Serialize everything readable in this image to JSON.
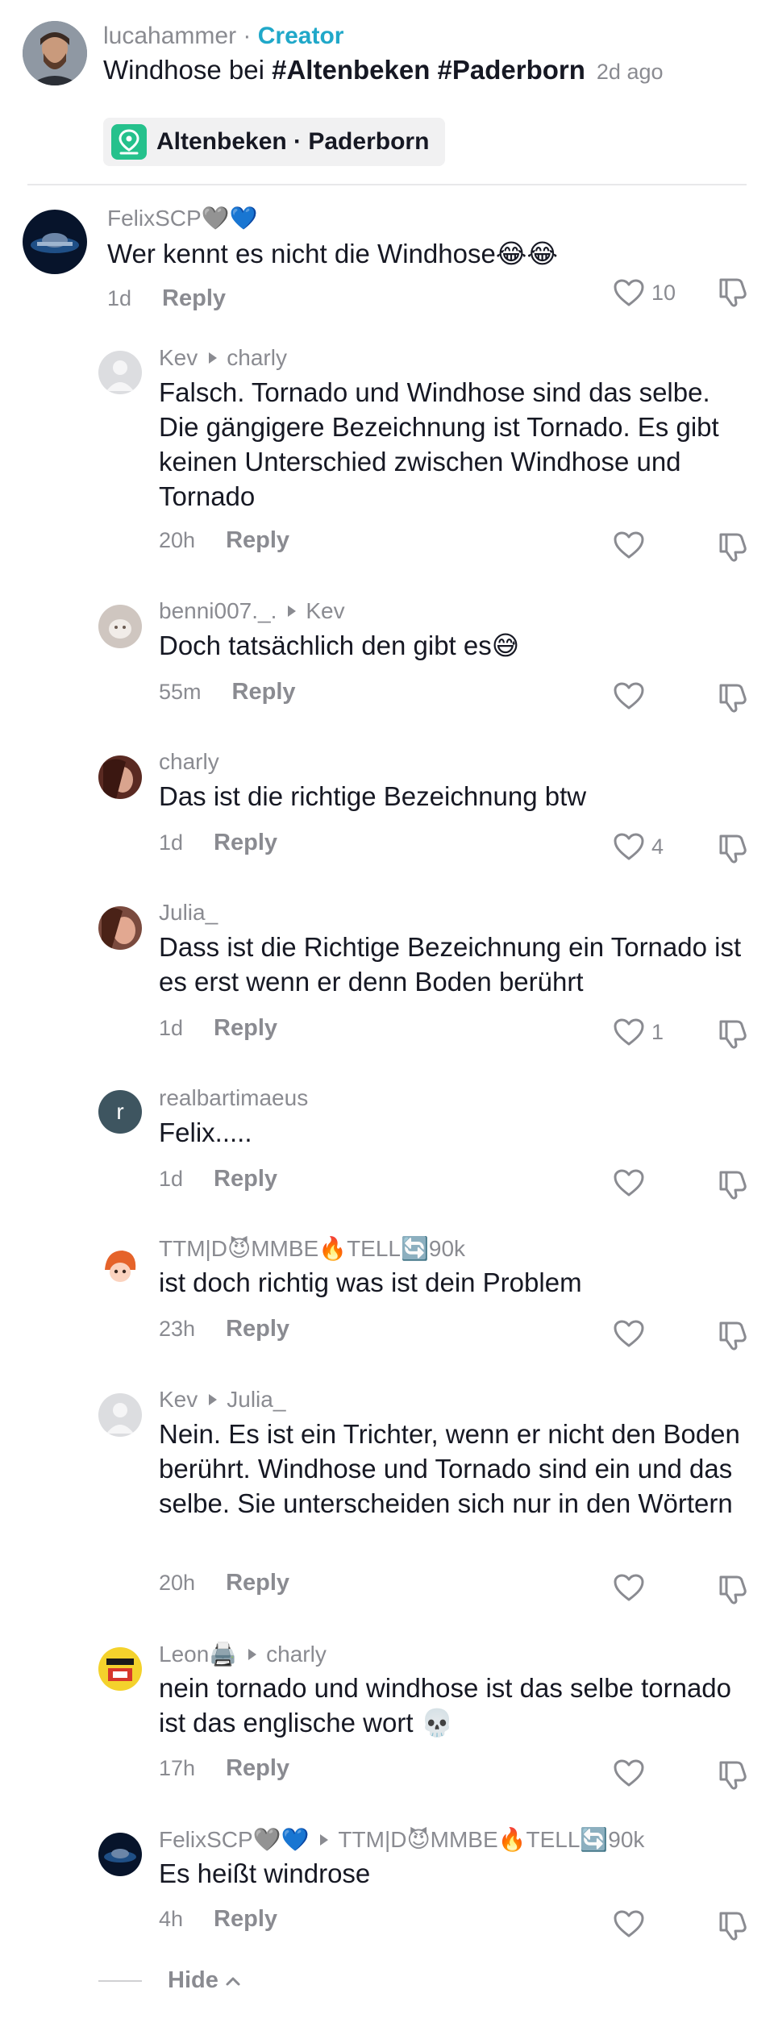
{
  "caption": {
    "author": "lucahammer",
    "separator": "·",
    "creator_badge": "Creator",
    "text_plain": "Windhose bei ",
    "hashtags": "#Altenbeken #Paderborn",
    "time_ago": "2d ago",
    "location": "Altenbeken · Paderborn"
  },
  "comments": [
    {
      "author": "FelixSCP🩶💙",
      "reply_to": "",
      "text": "Wer kennt es nicht die Windhose😂😂",
      "time": "1d",
      "reply_label": "Reply",
      "likes": "10"
    },
    {
      "author": "Kev",
      "reply_to": "charly",
      "text": "Falsch. Tornado und Windhose sind das selbe. Die gängigere Bezeichnung ist Tornado. Es gibt keinen Unterschied zwischen Windhose und Tornado",
      "time": "20h",
      "reply_label": "Reply",
      "likes": ""
    },
    {
      "author": "benni007._.",
      "reply_to": "Kev",
      "text": "Doch tatsächlich den gibt es😅",
      "time": "55m",
      "reply_label": "Reply",
      "likes": ""
    },
    {
      "author": "charly",
      "reply_to": "",
      "text": "Das ist die richtige Bezeichnung btw",
      "time": "1d",
      "reply_label": "Reply",
      "likes": "4"
    },
    {
      "author": "Julia_",
      "reply_to": "",
      "text": "Dass ist die Richtige Bezeichnung ein Tornado ist es erst wenn er denn Boden berührt",
      "time": "1d",
      "reply_label": "Reply",
      "likes": "1"
    },
    {
      "author": "realbartimaeus",
      "reply_to": "",
      "text": "Felix.....",
      "time": "1d",
      "reply_label": "Reply",
      "likes": "",
      "avatar_letter": "r"
    },
    {
      "author": "TTM|D😈MMBE🔥TELL🔄90k",
      "reply_to": "",
      "text": "ist doch richtig was ist dein Problem",
      "time": "23h",
      "reply_label": "Reply",
      "likes": ""
    },
    {
      "author": "Kev",
      "reply_to": "Julia_",
      "text": "Nein. Es ist ein Trichter, wenn er nicht den Boden berührt. Windhose und Tornado sind ein und das selbe. Sie unterscheiden sich nur in den Wörtern",
      "time": "20h",
      "reply_label": "Reply",
      "likes": ""
    },
    {
      "author": "Leon🖨️",
      "reply_to": "charly",
      "text": "nein tornado und windhose ist das selbe tornado ist das englische wort 💀",
      "time": "17h",
      "reply_label": "Reply",
      "likes": ""
    },
    {
      "author": "FelixSCP🩶💙",
      "reply_to": "TTM|D😈MMBE🔥TELL🔄90k",
      "text": "Es heißt windrose",
      "time": "4h",
      "reply_label": "Reply",
      "likes": ""
    }
  ],
  "hide_label": "Hide",
  "colors": {
    "accent": "#20a8c9",
    "location_badge": "#25c18c",
    "muted": "#8a8b91",
    "text": "#161823"
  }
}
